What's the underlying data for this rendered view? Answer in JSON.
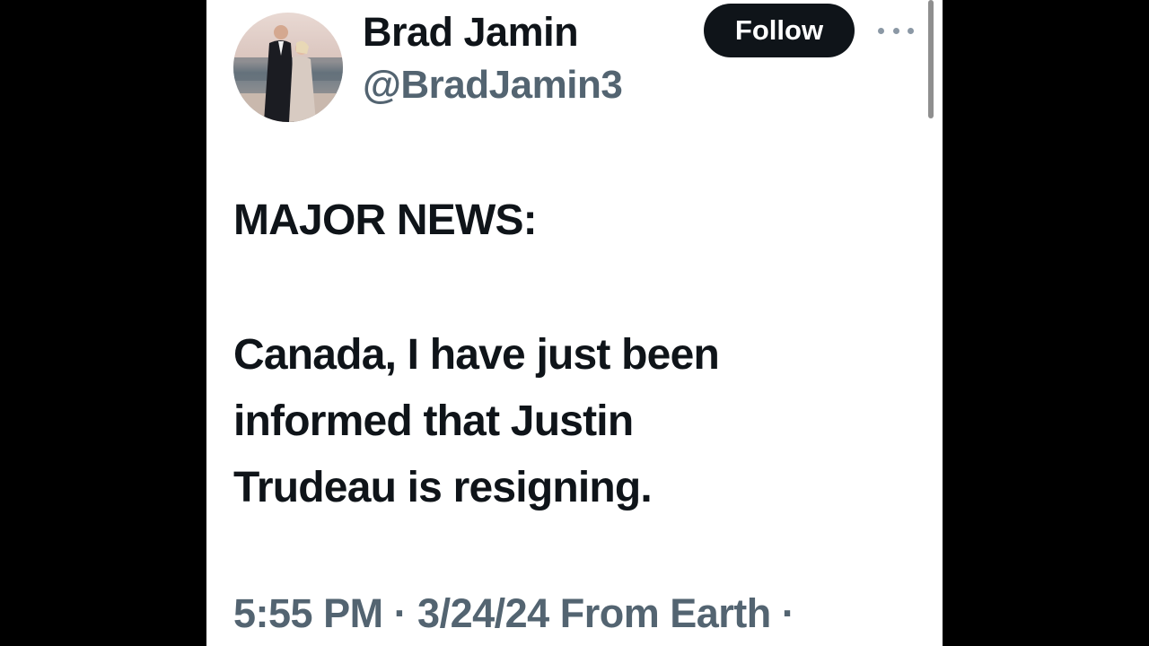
{
  "author": {
    "display_name": "Brad Jamin",
    "handle": "@BradJamin3",
    "avatar_icon": "profile-photo-couple-beach"
  },
  "actions": {
    "follow_label": "Follow",
    "more_icon": "more-horizontal-icon"
  },
  "tweet": {
    "lines": [
      "MAJOR NEWS:",
      "Canada, I have just been",
      "informed that Justin",
      "Trudeau is resigning."
    ]
  },
  "meta": {
    "text": "5:55 PM · 3/24/24 From Earth ·"
  },
  "colors": {
    "background": "#000000",
    "card": "#ffffff",
    "text_primary": "#0f1419",
    "text_secondary": "#536471",
    "button_bg": "#0f1419",
    "button_text": "#ffffff"
  }
}
